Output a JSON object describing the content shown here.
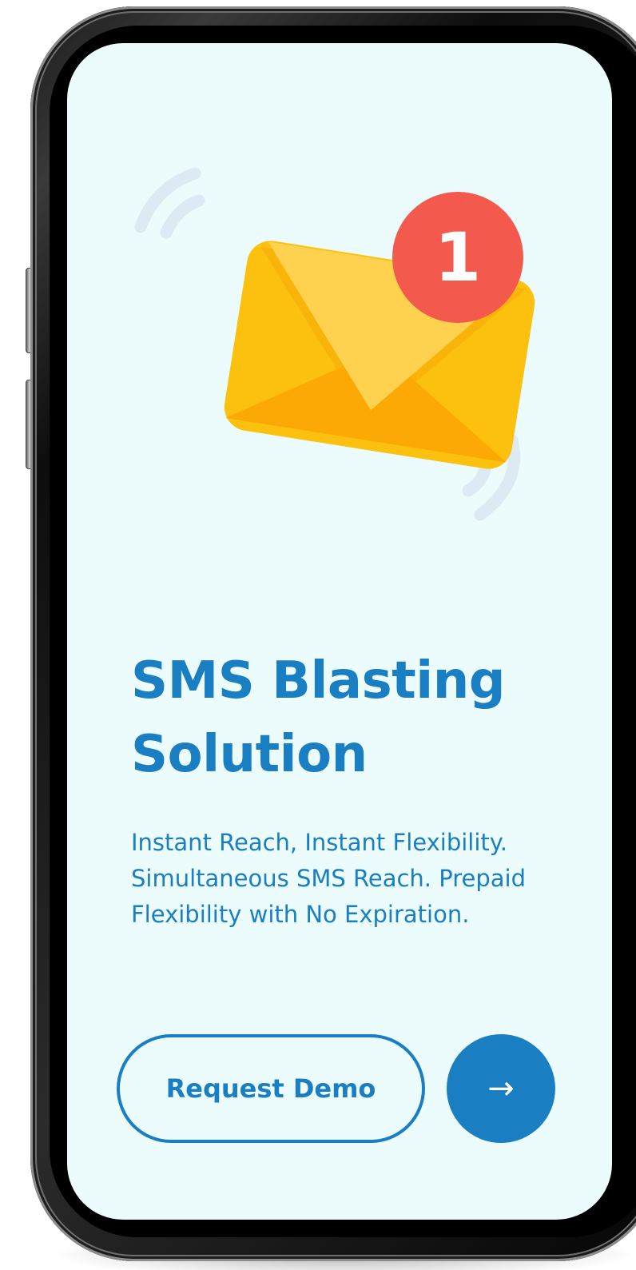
{
  "hero": {
    "badge_count": "1",
    "title": "SMS Blasting Solution",
    "description": "Instant Reach, Instant Flexibility. Simultaneous SMS Reach. Prepaid Flexibility with No Expiration."
  },
  "actions": {
    "request_demo_label": "Request Demo",
    "next_arrow": "→"
  },
  "colors": {
    "accent": "#1a7ec2",
    "screen_background": "#ecfcfc",
    "badge": "#f3594c",
    "envelope": "#fcc10e"
  },
  "icons": {
    "envelope": "envelope-icon",
    "badge": "notification-badge-icon",
    "vibration": "vibration-waves-icon",
    "arrow": "arrow-right-icon"
  }
}
